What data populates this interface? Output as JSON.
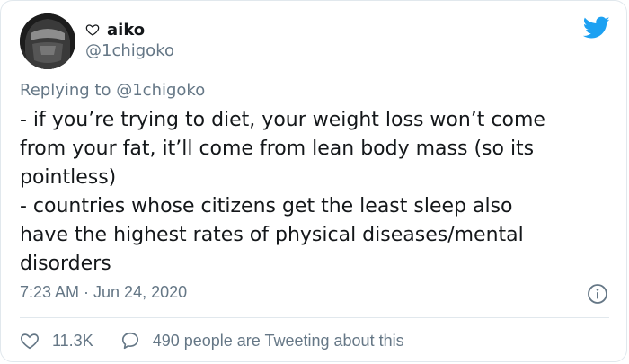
{
  "user": {
    "display_name": "aiko",
    "handle": "@1chigoko"
  },
  "reply": {
    "label": "Replying to",
    "target": "@1chigoko"
  },
  "tweet": {
    "lines": [
      "- if you’re trying to diet, your weight loss won’t come",
      "from your fat, it’ll come from lean body mass (so its",
      "pointless)",
      "- countries whose citizens get the least sleep also",
      "have the highest rates of physical diseases/mental",
      "disorders"
    ],
    "timestamp": "7:23 AM · Jun 24, 2020"
  },
  "stats": {
    "likes": "11.3K",
    "conversation": "490 people are Tweeting about this"
  },
  "colors": {
    "twitter_blue": "#1da1f2",
    "secondary_text": "#657786",
    "primary_text": "#14171a",
    "divider": "#e1e8ed"
  },
  "icons": [
    "heart-outline-icon",
    "twitter-bird-icon",
    "info-icon",
    "like-heart-icon",
    "conversation-bubble-icon"
  ]
}
